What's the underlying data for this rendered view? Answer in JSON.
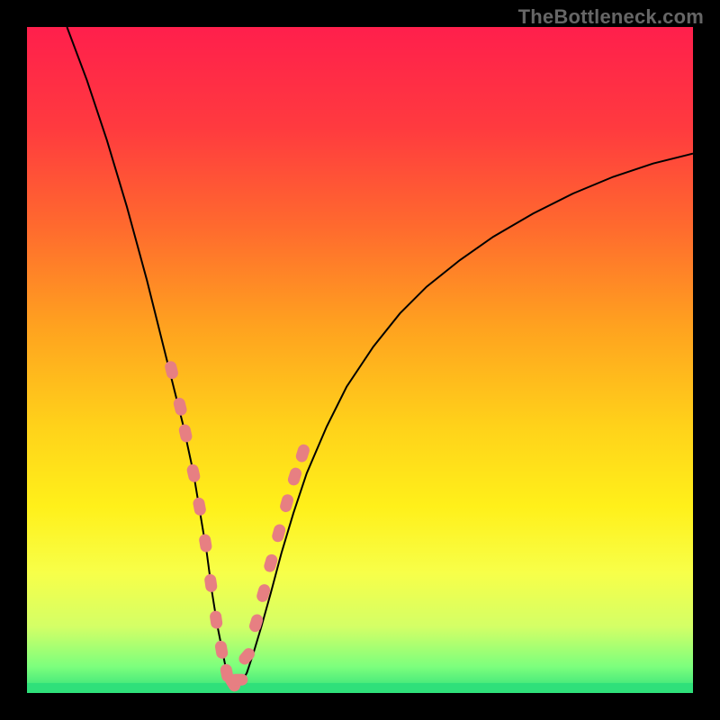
{
  "watermark": "TheBottleneck.com",
  "colors": {
    "frame": "#000000",
    "watermark": "#666666",
    "curve": "#000000",
    "marker_fill": "#e77f82",
    "marker_stroke": "#c45a5d",
    "green_band": "#2fe07a",
    "gradient_stops": [
      {
        "offset": 0.0,
        "color": "#ff1f4c"
      },
      {
        "offset": 0.15,
        "color": "#ff3a3f"
      },
      {
        "offset": 0.3,
        "color": "#ff6a2e"
      },
      {
        "offset": 0.45,
        "color": "#ffa21f"
      },
      {
        "offset": 0.6,
        "color": "#ffd21a"
      },
      {
        "offset": 0.72,
        "color": "#fff01a"
      },
      {
        "offset": 0.82,
        "color": "#f7ff49"
      },
      {
        "offset": 0.9,
        "color": "#d4ff66"
      },
      {
        "offset": 0.96,
        "color": "#7dff7d"
      },
      {
        "offset": 1.0,
        "color": "#2fe07a"
      }
    ]
  },
  "chart_data": {
    "type": "line",
    "title": "",
    "xlabel": "",
    "ylabel": "",
    "xlim": [
      0,
      100
    ],
    "ylim": [
      0,
      100
    ],
    "grid": false,
    "legend": false,
    "series": [
      {
        "name": "bottleneck-curve",
        "x": [
          6,
          9,
          12,
          15,
          18,
          20,
          22,
          23.5,
          25,
          26,
          27,
          27.8,
          28.6,
          29.4,
          30,
          30.6,
          31.3,
          32.1,
          33,
          34,
          35.2,
          36.6,
          38.2,
          40,
          42,
          45,
          48,
          52,
          56,
          60,
          65,
          70,
          76,
          82,
          88,
          94,
          100
        ],
        "y": [
          100,
          92,
          83,
          73,
          62,
          54,
          46,
          40,
          33,
          27,
          21,
          15,
          10,
          6,
          3,
          1.5,
          1,
          1.5,
          3,
          6,
          10,
          15,
          21,
          27,
          33,
          40,
          46,
          52,
          57,
          61,
          65,
          68.5,
          72,
          75,
          77.5,
          79.5,
          81
        ]
      }
    ],
    "markers": {
      "name": "highlighted-points",
      "x": [
        21.7,
        23.0,
        23.8,
        25.0,
        25.9,
        26.8,
        27.6,
        28.4,
        29.2,
        30.0,
        30.9,
        31.8,
        33.0,
        34.4,
        35.5,
        36.6,
        37.8,
        39.0,
        40.2,
        41.4
      ],
      "y": [
        48.5,
        43.0,
        39.0,
        33.0,
        28.0,
        22.5,
        16.5,
        11.0,
        6.5,
        3.0,
        1.5,
        2.0,
        5.5,
        10.5,
        15.0,
        19.5,
        24.0,
        28.5,
        32.5,
        36.0
      ]
    },
    "annotations": []
  }
}
